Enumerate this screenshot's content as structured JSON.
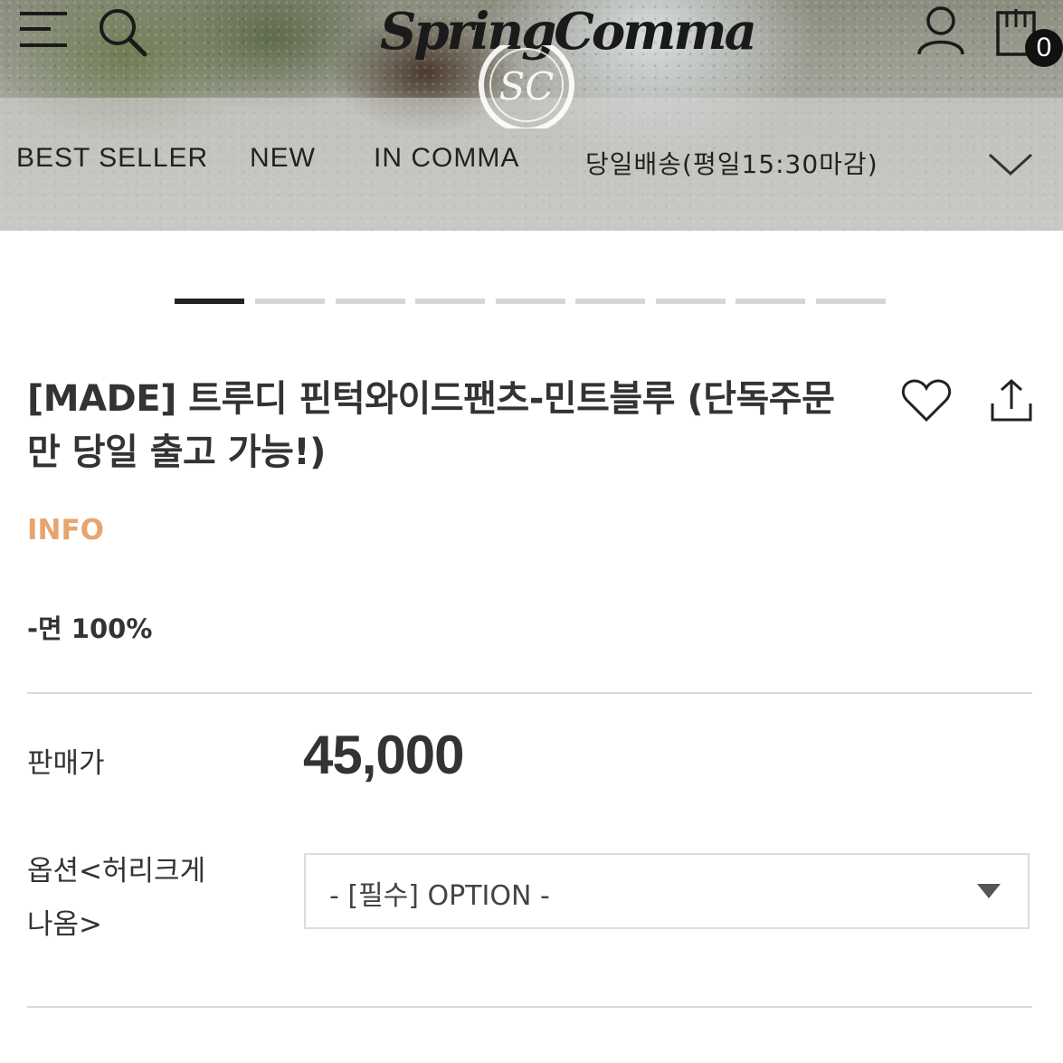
{
  "header": {
    "logo_text": "SpringComma",
    "seal_text": "SC",
    "cart_count": "0"
  },
  "nav": {
    "items": [
      {
        "label": "BEST SELLER"
      },
      {
        "label": "NEW"
      },
      {
        "label": "IN COMMA"
      },
      {
        "label": "당일배송(평일15:30마감)"
      }
    ]
  },
  "carousel": {
    "slide_count": 9,
    "active_index": 0
  },
  "product": {
    "title": "[MADE] 트루디 핀턱와이드팬츠-민트블루 (단독주문만 당일 출고 가능!)",
    "info_label": "INFO",
    "material": "-면 100%",
    "price_label": "판매가",
    "price": "45,000",
    "option_label_line1": "옵션<허리크게",
    "option_label_line2": "나옴>",
    "option_selected": "- [필수] OPTION -"
  },
  "colors": {
    "accent": "#e8a46e",
    "text": "#333333",
    "active_dot": "#222222"
  }
}
